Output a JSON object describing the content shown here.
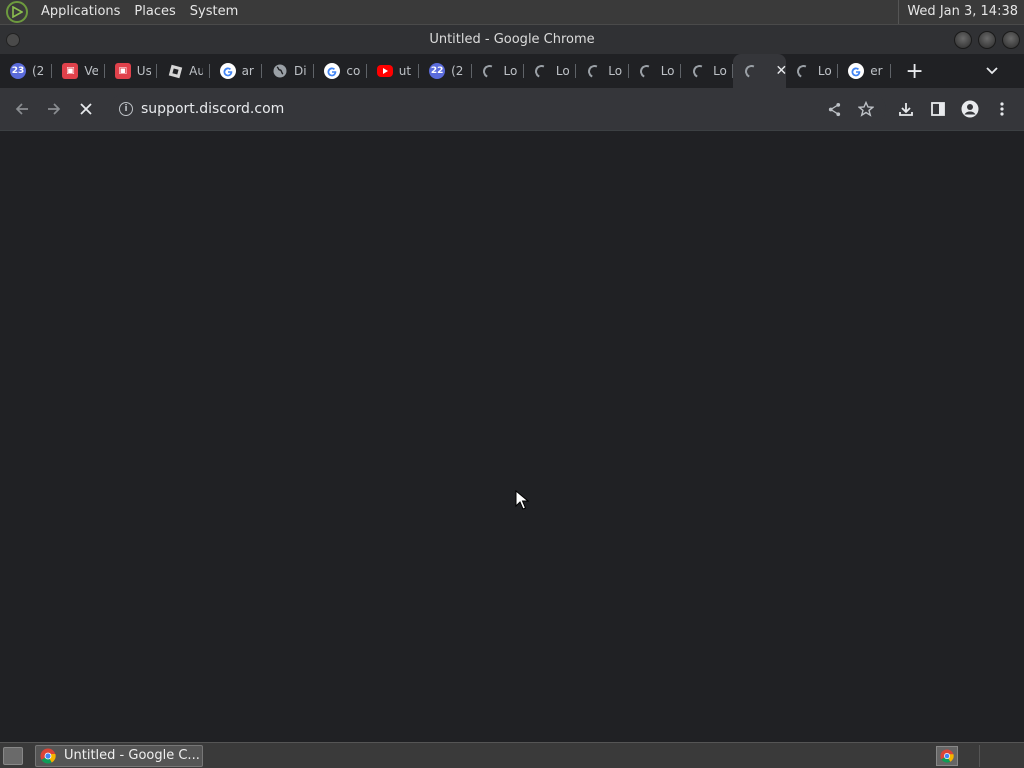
{
  "panel": {
    "menu_applications": "Applications",
    "menu_places": "Places",
    "menu_system": "System",
    "clock": "Wed Jan  3, 14:38"
  },
  "window": {
    "title": "Untitled - Google Chrome"
  },
  "tabs": [
    {
      "label": "(2",
      "icon": "calendar-icon",
      "badge": "23"
    },
    {
      "label": "Ve",
      "icon": "red-robot-icon"
    },
    {
      "label": "Us",
      "icon": "red-robot-icon"
    },
    {
      "label": "Au",
      "icon": "roblox-icon"
    },
    {
      "label": "ar",
      "icon": "google-icon"
    },
    {
      "label": "Di",
      "icon": "globe-icon"
    },
    {
      "label": "co",
      "icon": "google-icon"
    },
    {
      "label": "ut",
      "icon": "youtube-icon"
    },
    {
      "label": "(2",
      "icon": "calendar-icon",
      "badge": "22"
    },
    {
      "label": "Lo",
      "icon": "loading-spinner-icon"
    },
    {
      "label": "Lo",
      "icon": "loading-spinner-icon"
    },
    {
      "label": "Lo",
      "icon": "loading-spinner-icon"
    },
    {
      "label": "Lo",
      "icon": "loading-spinner-icon"
    },
    {
      "label": "Lo",
      "icon": "loading-spinner-icon"
    },
    {
      "label": "",
      "icon": "loading-spinner-icon",
      "active": true
    },
    {
      "label": "Lo",
      "icon": "loading-spinner-icon"
    },
    {
      "label": "er",
      "icon": "google-icon"
    }
  ],
  "toolbar": {
    "url": "support.discord.com"
  },
  "taskbar": {
    "task_label": "Untitled - Google C..."
  },
  "colors": {
    "background": "#202124",
    "toolbar": "#35363a",
    "panel": "#3a3a3a"
  }
}
